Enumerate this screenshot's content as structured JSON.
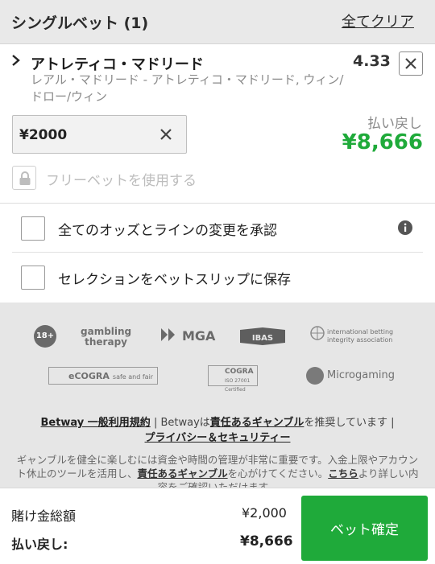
{
  "header": {
    "title": "シングルベット (1)",
    "clear_all": "全てクリア"
  },
  "bet": {
    "selection": "アトレティコ・マドリード",
    "odds": "4.33",
    "market": "レアル・マドリード - アトレティコ・マドリード, ウィン/ドロー/ウィン",
    "stake_value": "¥2000",
    "payout_label": "払い戻し",
    "payout_value": "¥8,666",
    "freebet_label": "フリーベットを使用する"
  },
  "options": {
    "accept_odds": "全てのオッズとラインの変更を承認",
    "save_selection": "セレクションをベットスリップに保存"
  },
  "footer": {
    "logos": {
      "age": "18+",
      "gambling_line1": "gambling",
      "gambling_line2": "therapy",
      "mga": "MGA",
      "ibas": "IBAS",
      "ibia_line1": "international betting",
      "ibia_line2": "integrity association",
      "ecogra": "eCOGRA",
      "ecogra_sub": "safe and fair",
      "ecogra_cert": "COGRA",
      "ecogra_cert_sub": "ISO 27001 Certified",
      "microgaming": "Microgaming"
    },
    "links": {
      "terms": "Betway 一般利用規約",
      "sep1": " | Betwayは",
      "responsible": "責任あるギャンブル",
      "promote": "を推奨しています |",
      "privacy": "プライバシー＆セキュリティー"
    },
    "responsible_text": {
      "part1": "ギャンブルを健全に楽しむには資金や時間の管理が非常に重要です。入金上限やアカウント休止のツールを活用し、",
      "link1": "責任あるギャンブル",
      "part2": "を心がけてください。",
      "link2": "こちら",
      "part3": "より詳しい内容をご確認いただけます。"
    }
  },
  "summary": {
    "total_label": "賭け金総額",
    "total_value": "¥2,000",
    "return_label": "払い戻し:",
    "return_value": "¥8,666",
    "place_bet": "ベット確定"
  },
  "colors": {
    "accent_green": "#1faa3a",
    "header_bg": "#e9e9e9",
    "footer_bg": "#e6e6e6"
  },
  "icons": [
    "chevron-right-icon",
    "close-icon",
    "clear-icon",
    "lock-icon",
    "info-icon"
  ]
}
